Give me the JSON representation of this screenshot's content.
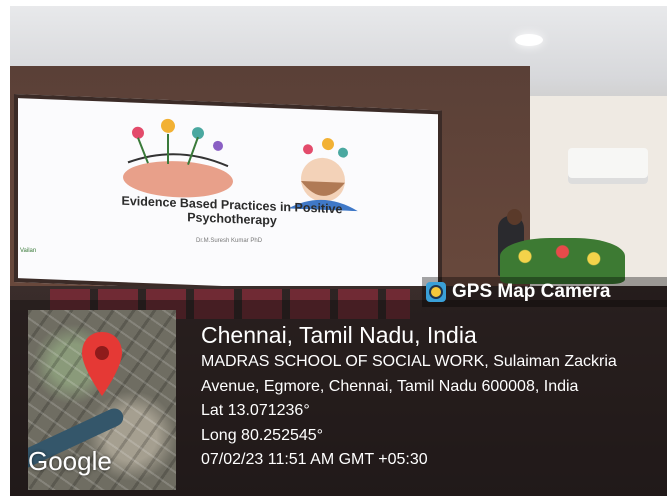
{
  "photo": {
    "slide": {
      "title": "Evidence Based Practices in Positive Psychotherapy",
      "author": "Dr.M.Suresh Kumar PhD",
      "logo_text": "Vailan"
    }
  },
  "stamp": {
    "app_name": "GPS Map Camera",
    "map_attribution": "Google",
    "location_title": "Chennai, Tamil Nadu, India",
    "address_line1": "MADRAS SCHOOL OF SOCIAL WORK, Sulaiman Zackria",
    "address_line2": "Avenue, Egmore, Chennai, Tamil Nadu 600008, India",
    "latitude": "Lat 13.071236°",
    "longitude": "Long 80.252545°",
    "datetime": "07/02/23 11:51 AM GMT +05:30",
    "pin_color": "#e53935"
  }
}
